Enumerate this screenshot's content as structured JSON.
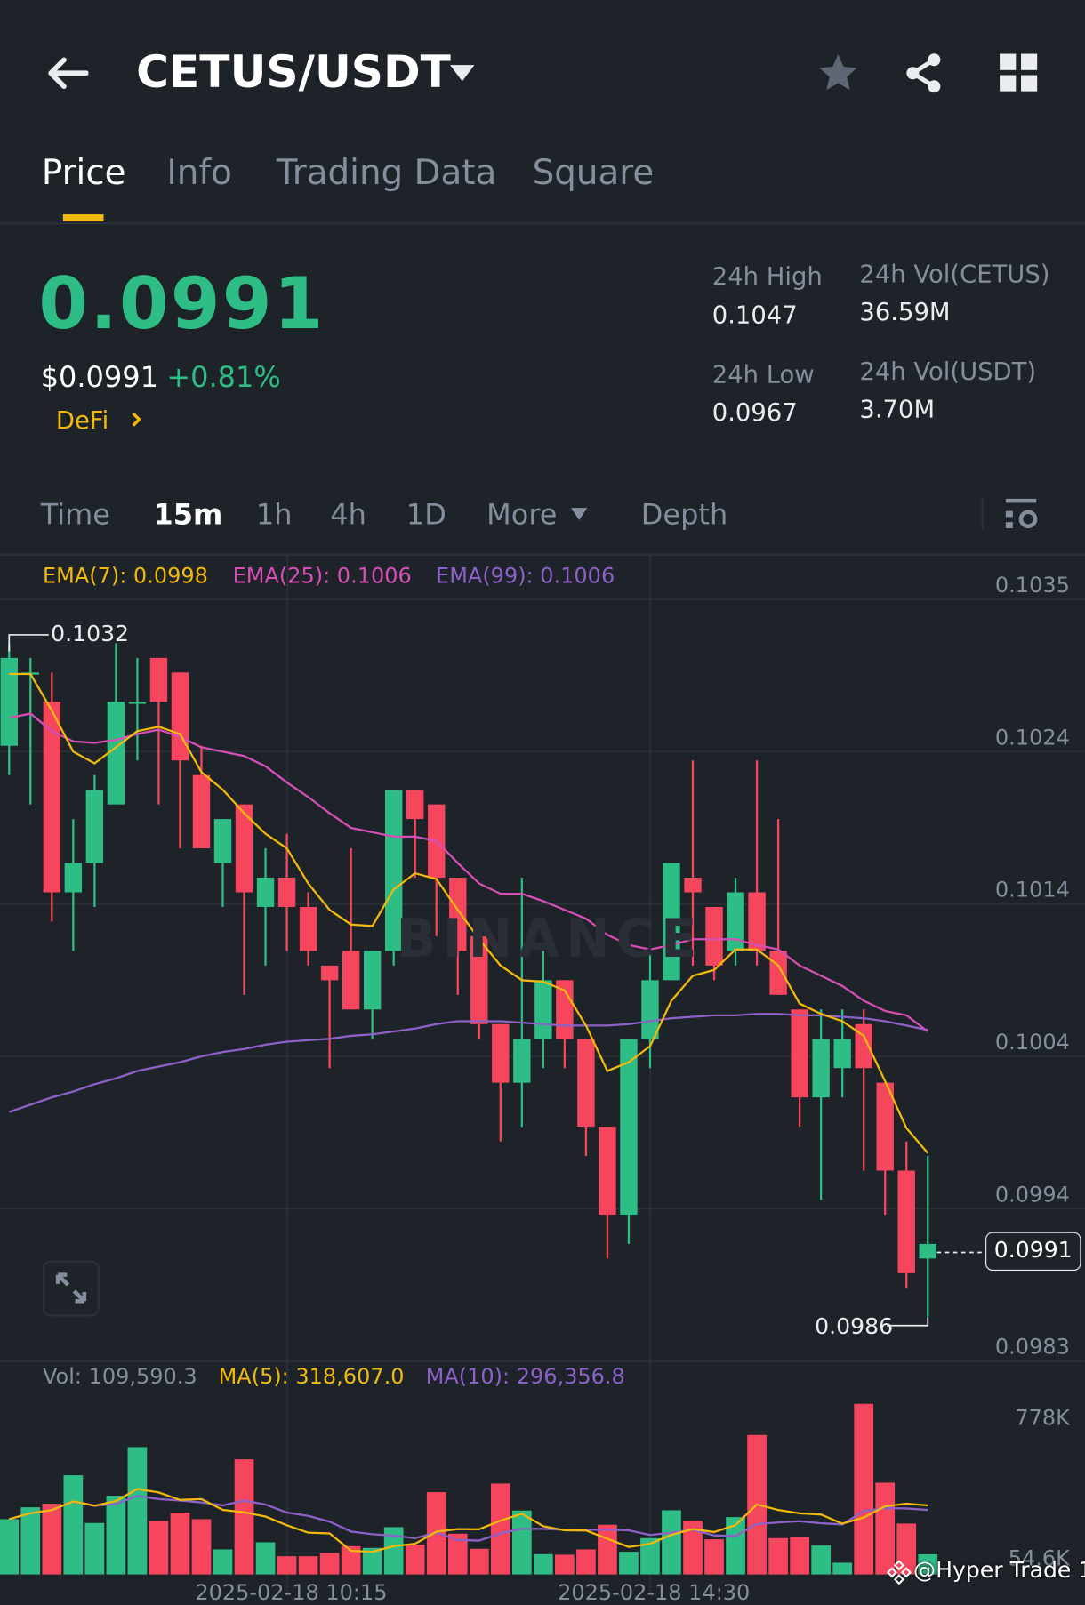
{
  "header": {
    "title": "CETUS/USDT",
    "icons": [
      "back-arrow-icon",
      "caret-down-icon",
      "star-icon",
      "share-icon",
      "grid-icon"
    ]
  },
  "tabs": [
    {
      "label": "Price",
      "active": true
    },
    {
      "label": "Info"
    },
    {
      "label": "Trading Data"
    },
    {
      "label": "Square"
    }
  ],
  "ticker": {
    "last_price": "0.0991",
    "usd_price": "$0.0991",
    "change": "+0.81%",
    "category": "DeFi",
    "stats": {
      "high_label": "24h High",
      "high": "0.1047",
      "low_label": "24h Low",
      "low": "0.0967",
      "vol_base_label": "24h Vol(CETUS)",
      "vol_base": "36.59M",
      "vol_quote_label": "24h Vol(USDT)",
      "vol_quote": "3.70M"
    }
  },
  "intervals": {
    "items": [
      "Time",
      "15m",
      "1h",
      "4h",
      "1D",
      "More",
      "Depth"
    ],
    "active": "15m"
  },
  "colors": {
    "up": "#2ebd85",
    "down": "#f6465d",
    "ema7": "#f0b90b",
    "ema25": "#d54fb5",
    "ema99": "#8c62c9",
    "accent": "#f0b90b",
    "bg": "#1e2229"
  },
  "chart_data": {
    "type": "candlestick",
    "indicators": {
      "ema7": "EMA(7): 0.0998",
      "ema25": "EMA(25): 0.1006",
      "ema99": "EMA(99): 0.1006"
    },
    "price_axis": [
      "0.1035",
      "0.1024",
      "0.1014",
      "0.1004",
      "0.0994",
      "0.0983"
    ],
    "ylim": [
      0.0983,
      0.1035
    ],
    "high_marker": "0.1032",
    "low_marker": "0.0986",
    "current_price_label": "0.0991",
    "x_labels": [
      "2025-02-18 10:15",
      "2025-02-18 14:30"
    ],
    "candles": [
      [
        0.1025,
        0.1032,
        0.1023,
        0.1031
      ],
      [
        0.103,
        0.1031,
        0.1021,
        0.103
      ],
      [
        0.1028,
        0.103,
        0.1013,
        0.1015
      ],
      [
        0.1015,
        0.102,
        0.1011,
        0.1017
      ],
      [
        0.1017,
        0.1023,
        0.1014,
        0.1022
      ],
      [
        0.1021,
        0.1032,
        0.1021,
        0.1028
      ],
      [
        0.10279,
        0.1031,
        0.1024,
        0.1028
      ],
      [
        0.1031,
        0.1031,
        0.1021,
        0.1028
      ],
      [
        0.103,
        0.103,
        0.1018,
        0.1024
      ],
      [
        0.1023,
        0.1025,
        0.1018,
        0.1018
      ],
      [
        0.1017,
        0.102,
        0.1014,
        0.102
      ],
      [
        0.1021,
        0.1021,
        0.1008,
        0.1015
      ],
      [
        0.1014,
        0.1018,
        0.101,
        0.1016
      ],
      [
        0.1016,
        0.1019,
        0.1011,
        0.1014
      ],
      [
        0.1014,
        0.1015,
        0.101,
        0.1011
      ],
      [
        0.101,
        0.101,
        0.1003,
        0.1009
      ],
      [
        0.1011,
        0.1018,
        0.1007,
        0.1007
      ],
      [
        0.1007,
        0.1011,
        0.1005,
        0.1011
      ],
      [
        0.1011,
        0.1022,
        0.101,
        0.1022
      ],
      [
        0.1022,
        0.1022,
        0.1016,
        0.102
      ],
      [
        0.1021,
        0.1021,
        0.1012,
        0.1016
      ],
      [
        0.1016,
        0.1016,
        0.1008,
        0.1011
      ],
      [
        0.1012,
        0.1013,
        0.1005,
        0.1006
      ],
      [
        0.1006,
        0.1006,
        0.0998,
        0.1002
      ],
      [
        0.1002,
        0.1016,
        0.0999,
        0.1005
      ],
      [
        0.1005,
        0.1011,
        0.1003,
        0.1009
      ],
      [
        0.1009,
        0.1009,
        0.1003,
        0.1005
      ],
      [
        0.1005,
        0.1005,
        0.0997,
        0.0999
      ],
      [
        0.0999,
        0.0999,
        0.099,
        0.0993
      ],
      [
        0.0993,
        0.1005,
        0.0991,
        0.1005
      ],
      [
        0.1005,
        0.1011,
        0.1003,
        0.1009
      ],
      [
        0.1009,
        0.1017,
        0.1009,
        0.1017
      ],
      [
        0.1016,
        0.1024,
        0.101,
        0.1015
      ],
      [
        0.1014,
        0.1014,
        0.1009,
        0.101
      ],
      [
        0.1011,
        0.1016,
        0.101,
        0.1015
      ],
      [
        0.1015,
        0.1024,
        0.101,
        0.1011
      ],
      [
        0.1011,
        0.102,
        0.1008,
        0.1008
      ],
      [
        0.1007,
        0.1007,
        0.0999,
        0.1001
      ],
      [
        0.1001,
        0.1007,
        0.0994,
        0.1005
      ],
      [
        0.1003,
        0.1007,
        0.1001,
        0.1005
      ],
      [
        0.1006,
        0.1007,
        0.0996,
        0.1003
      ],
      [
        0.1002,
        0.1002,
        0.0993,
        0.0996
      ],
      [
        0.0996,
        0.0998,
        0.0988,
        0.0989
      ],
      [
        0.099,
        0.0997,
        0.0986,
        0.0991
      ]
    ],
    "ema7": [
      0.10299,
      0.10299,
      0.10274,
      0.10246,
      0.10238,
      0.10249,
      0.1026,
      0.10263,
      0.10258,
      0.10232,
      0.1022,
      0.10204,
      0.1019,
      0.1018,
      0.10156,
      0.10138,
      0.10128,
      0.10127,
      0.10152,
      0.10163,
      0.10159,
      0.10138,
      0.10118,
      0.101,
      0.1009,
      0.10089,
      0.10083,
      0.10059,
      0.10028,
      0.10034,
      0.10045,
      0.10076,
      0.10093,
      0.10097,
      0.10111,
      0.10111,
      0.101,
      0.10074,
      0.10067,
      0.10062,
      0.10052,
      0.10021,
      0.09989,
      0.09972
    ],
    "ema25": [
      0.10269,
      0.10272,
      0.1026,
      0.10253,
      0.10252,
      0.10254,
      0.10258,
      0.10261,
      0.10256,
      0.10249,
      0.10246,
      0.10243,
      0.10236,
      0.10225,
      0.10215,
      0.10204,
      0.10194,
      0.10191,
      0.10188,
      0.10188,
      0.10185,
      0.1017,
      0.10156,
      0.10149,
      0.10149,
      0.10144,
      0.10138,
      0.10132,
      0.10121,
      0.10114,
      0.10111,
      0.10114,
      0.10118,
      0.10118,
      0.10118,
      0.10114,
      0.10111,
      0.101,
      0.10093,
      0.10086,
      0.10076,
      0.10069,
      0.10066,
      0.10055
    ],
    "ema99": [
      0.1,
      0.10005,
      0.1001,
      0.10014,
      0.10019,
      0.10023,
      0.10028,
      0.10031,
      0.10034,
      0.10038,
      0.10041,
      0.10043,
      0.10046,
      0.10048,
      0.10049,
      0.1005,
      0.10052,
      0.10053,
      0.10055,
      0.10057,
      0.1006,
      0.10062,
      0.10062,
      0.10062,
      0.10061,
      0.1006,
      0.10059,
      0.10059,
      0.10059,
      0.1006,
      0.10062,
      0.10064,
      0.10065,
      0.10066,
      0.10066,
      0.10067,
      0.10067,
      0.10066,
      0.10066,
      0.10065,
      0.10064,
      0.10062,
      0.10059,
      0.10056
    ],
    "volume": {
      "legend_vol": "Vol: 109,590.3",
      "legend_ma5": "MA(5): 318,607.0",
      "legend_ma10": "MA(10): 296,356.8",
      "axis": [
        "778K",
        "54.6K"
      ],
      "unit": "K",
      "values": [
        284.3,
        343.4,
        361.1,
        502.9,
        265.1,
        401.0,
        643.1,
        275.5,
        316.8,
        284.3,
        133.7,
        582.6,
        169.2,
        99.7,
        99.7,
        116.0,
        149.9,
        141.1,
        244.5,
        157.3,
        418.7,
        211.9,
        136.7,
        461.5,
        327.2,
        110.1,
        107.2,
        133.7,
        256.3,
        121.9,
        189.8,
        328.6,
        276.9,
        183.9,
        294.7,
        703.7,
        189.8,
        195.7,
        152.9,
        67.3,
        858.7,
        465.9,
        262.2,
        109.6
      ]
    }
  },
  "watermark": {
    "brand": "BINANCE",
    "credit": "@Hyper Trade 1"
  }
}
